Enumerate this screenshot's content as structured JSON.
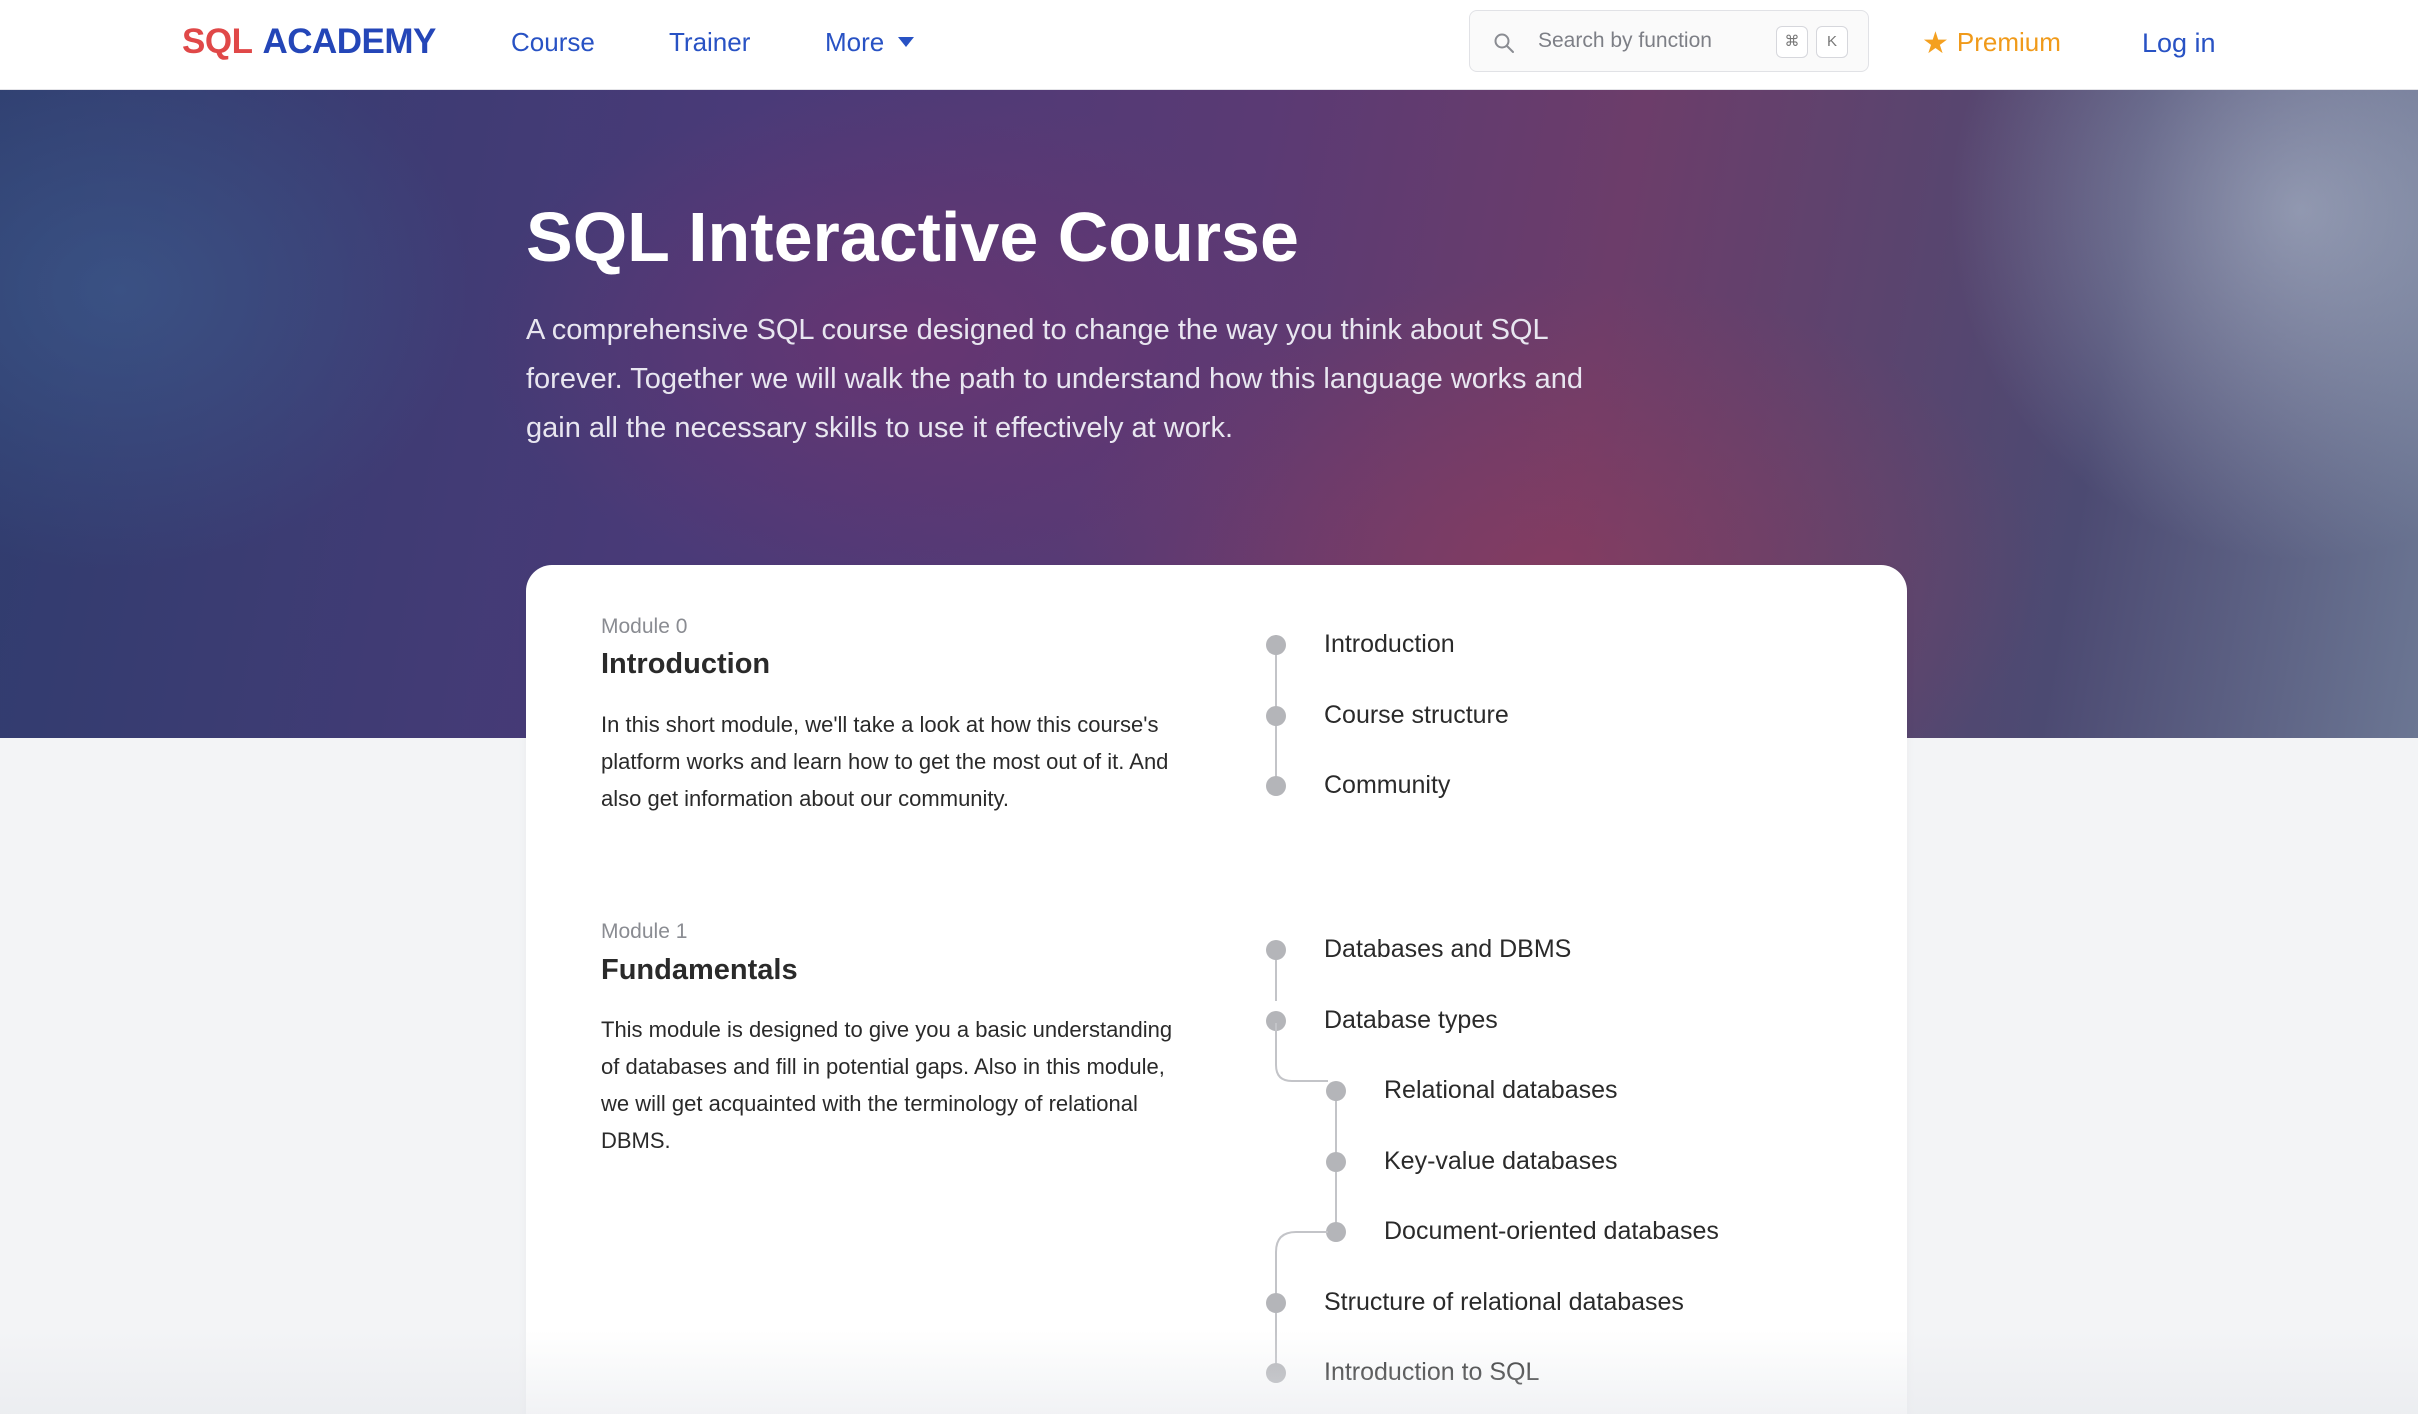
{
  "nav": {
    "logo_sql": "SQL",
    "logo_academy": "ACADEMY",
    "course": "Course",
    "trainer": "Trainer",
    "more": "More",
    "search_placeholder": "Search by function",
    "kbd_cmd": "⌘",
    "kbd_k": "K",
    "premium": "Premium",
    "login": "Log in"
  },
  "hero": {
    "title": "SQL Interactive Course",
    "description": "A comprehensive SQL course designed to change the way you think about SQL forever. Together we will walk the path to understand how this language works and gain all the necessary skills to use it effectively at work."
  },
  "modules": [
    {
      "label": "Module 0",
      "title": "Introduction",
      "description": "In this short module, we'll take a look at how this course's platform works and learn how to get the most out of it. And also get information about our community.",
      "lessons": [
        "Introduction",
        "Course structure",
        "Community"
      ]
    },
    {
      "label": "Module 1",
      "title": "Fundamentals",
      "description": "This module is designed to give you a basic understanding of databases and fill in potential gaps. Also in this module, we will get acquainted with the terminology of relational DBMS.",
      "lessons": [
        "Databases and DBMS",
        "Database types",
        "Structure of relational databases",
        "Introduction to SQL"
      ],
      "sublessons": [
        "Relational databases",
        "Key-value databases",
        "Document-oriented databases"
      ]
    }
  ],
  "colors": {
    "brand_red": "#e04848",
    "brand_blue": "#2446b8",
    "link_blue": "#2852c4",
    "premium_orange": "#f09a1a"
  }
}
